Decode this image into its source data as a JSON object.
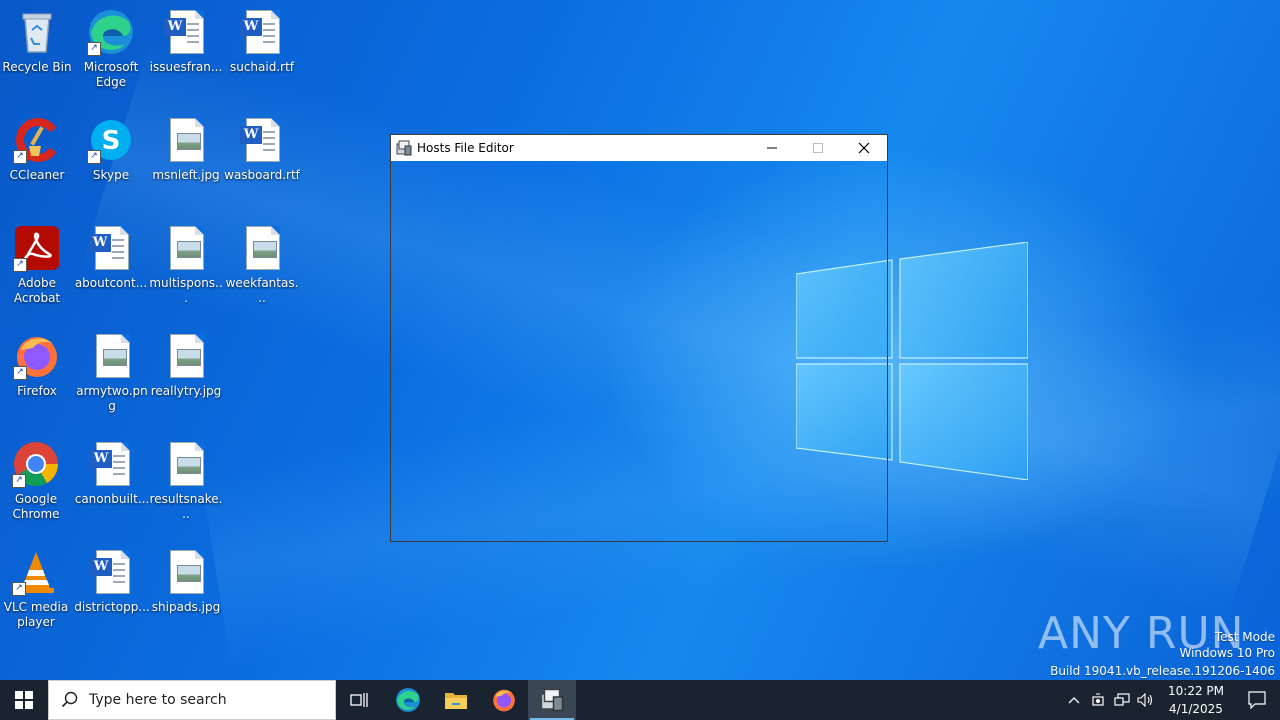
{
  "desktop": {
    "icons": [
      {
        "label": "Recycle Bin"
      },
      {
        "label": "Microsoft Edge"
      },
      {
        "label": "issuesfran..."
      },
      {
        "label": "suchaid.rtf"
      },
      {
        "label": "CCleaner"
      },
      {
        "label": "Skype"
      },
      {
        "label": "msnleft.jpg"
      },
      {
        "label": "wasboard.rtf"
      },
      {
        "label": "Adobe Acrobat"
      },
      {
        "label": "aboutcont..."
      },
      {
        "label": "multispons..."
      },
      {
        "label": "weekfantas..."
      },
      {
        "label": "Firefox"
      },
      {
        "label": "armytwo.png"
      },
      {
        "label": "reallytry.jpg"
      },
      {
        "label": "Google Chrome"
      },
      {
        "label": "canonbuilt..."
      },
      {
        "label": "resultsnake..."
      },
      {
        "label": "VLC media player"
      },
      {
        "label": "districtopp..."
      },
      {
        "label": "shipads.jpg"
      }
    ]
  },
  "window": {
    "title": "Hosts File Editor",
    "minimize_icon": "minimize-icon",
    "maximize_icon": "maximize-icon",
    "close_icon": "close-icon"
  },
  "watermark": {
    "brand": "ANY RUN",
    "line1": "Test Mode",
    "line2": "Windows 10 Pro",
    "line3": "Build 19041.vb_release.191206-1406"
  },
  "taskbar": {
    "search_placeholder": "Type here to search",
    "time": "10:22 PM",
    "date": "4/1/2025"
  },
  "colors": {
    "desktop_blue": "#0b6ee0",
    "taskbar": "#1a2430",
    "active_indicator": "#76b9ed"
  }
}
